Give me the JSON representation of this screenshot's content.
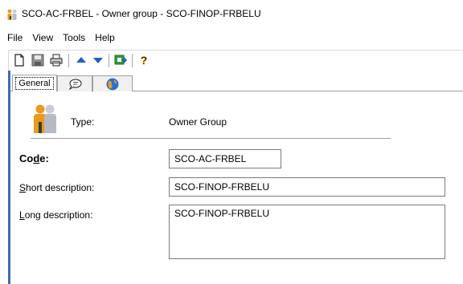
{
  "window": {
    "title": "SCO-AC-FRBEL - Owner group - SCO-FINOP-FRBELU",
    "icon": "owner-group-icon"
  },
  "menu": {
    "items": [
      "File",
      "View",
      "Tools",
      "Help"
    ]
  },
  "toolbar": {
    "buttons": [
      {
        "name": "new-icon"
      },
      {
        "name": "save-icon"
      },
      {
        "name": "print-icon"
      },
      {
        "name": "previous-icon"
      },
      {
        "name": "next-icon"
      },
      {
        "name": "refresh-icon"
      },
      {
        "name": "help-icon"
      }
    ]
  },
  "tabs": {
    "general": "General",
    "notes_icon": "notes-icon",
    "globe_icon": "globe-icon"
  },
  "form": {
    "type_label": "Type:",
    "type_value": "Owner Group",
    "code_label_pre": "Co",
    "code_label_u": "d",
    "code_label_post": "e:",
    "code_value": "SCO-AC-FRBEL",
    "short_label_u": "S",
    "short_label_rest": "hort description:",
    "short_value": "SCO-FINOP-FRBELU",
    "long_label_u": "L",
    "long_label_rest": "ong description:",
    "long_value": "SCO-FINOP-FRBELU"
  },
  "colors": {
    "accent_edge": "#3a6fb5",
    "arrow_blue": "#1f5fc0",
    "person_orange": "#e89a1c"
  }
}
